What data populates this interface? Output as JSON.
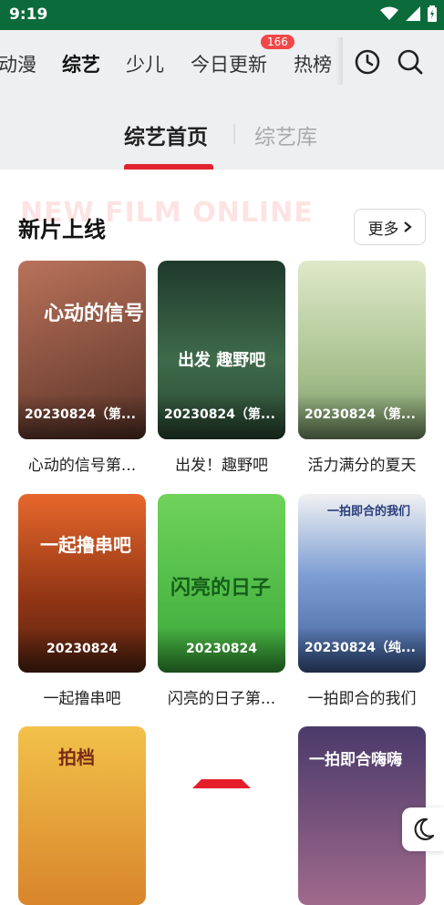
{
  "status": {
    "time": "9:19"
  },
  "nav": {
    "tabs": [
      {
        "label": "动漫"
      },
      {
        "label": "综艺"
      },
      {
        "label": "少儿"
      },
      {
        "label": "今日更新"
      },
      {
        "label": "热榜"
      }
    ],
    "badge": "166"
  },
  "subtabs": {
    "active": "综艺首页",
    "inactive": "综艺库"
  },
  "section": {
    "watermark": "NEW FILM ONLINE",
    "title": "新片上线",
    "more_label": "更多"
  },
  "cards": [
    {
      "date": "20230824（第...",
      "title": "心动的信号第...",
      "art": "心动的信号",
      "color": "#7a4a3a"
    },
    {
      "date": "20230824（第...",
      "title": "出发！趣野吧",
      "art": "出发 趣野吧",
      "color": "#2f5a3a"
    },
    {
      "date": "20230824（第...",
      "title": "活力满分的夏天",
      "art": "",
      "color": "#9fb68a"
    },
    {
      "date": "20230824",
      "title": "一起撸串吧",
      "art": "一起撸串吧",
      "color": "#a2481e"
    },
    {
      "date": "20230824",
      "title": "闪亮的日子第...",
      "art": "闪亮的日子",
      "color": "#52b847"
    },
    {
      "date": "20230824（纯...",
      "title": "一拍即合的我们",
      "art": "一拍即合的我们",
      "color": "#4f6ea8"
    },
    {
      "date": "",
      "title": "",
      "art": "拍档",
      "color": "#e0a447"
    },
    {
      "date": "",
      "title": "",
      "art": "",
      "color": "#ffffff"
    },
    {
      "date": "",
      "title": "",
      "art": "一拍即合嗨嗨",
      "color": "#6c4a7e"
    }
  ]
}
